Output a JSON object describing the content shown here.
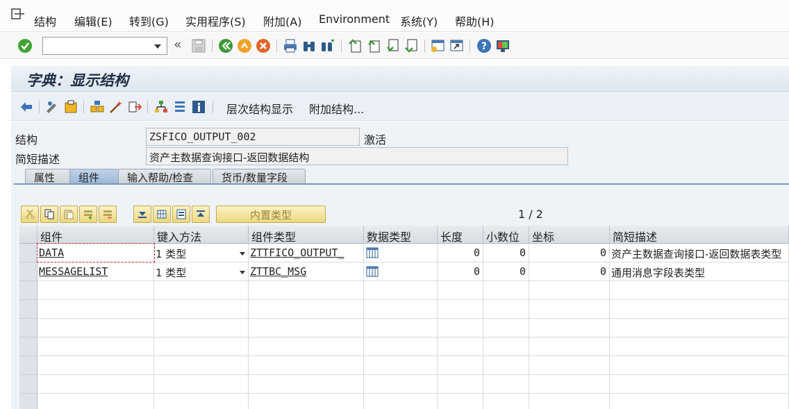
{
  "menubar": {
    "items": [
      "结构",
      "编辑(E)",
      "转到(G)",
      "实用程序(S)",
      "附加(A)",
      "Environment",
      "系统(Y)",
      "帮助(H)"
    ]
  },
  "toolbar": {
    "command_field_value": "",
    "back_glyph": "«"
  },
  "page": {
    "title": "字典：显示结构"
  },
  "app_toolbar": {
    "hierarchy_label": "层次结构显示",
    "append_structure_label": "附加结构..."
  },
  "form": {
    "structure_label": "结构",
    "structure_value": "ZSFICO_OUTPUT_002",
    "status": "激活",
    "short_desc_label": "简短描述",
    "short_desc_value": "资产主数据查询接口-返回数据结构"
  },
  "tabs": [
    "属性",
    "组件",
    "输入帮助/检查",
    "货币/数量字段"
  ],
  "grid_toolbar": {
    "builtin_type_label": "内置类型",
    "pager": "1 / 2"
  },
  "table": {
    "columns": [
      "组件",
      "键入方法",
      "组件类型",
      "数据类型",
      "长度",
      "小数位",
      "坐标",
      "简短描述"
    ],
    "rows": [
      {
        "component": "DATA",
        "typing_method": "1 类型",
        "component_type": "ZTTFICO_OUTPUT_",
        "data_type": "",
        "length": "0",
        "decimals": "0",
        "coordinate": "0",
        "description": "资产主数据查询接口-返回数据表类型"
      },
      {
        "component": "MESSAGELIST",
        "typing_method": "1 类型",
        "component_type": "ZTTBC_MSG",
        "data_type": "",
        "length": "0",
        "decimals": "0",
        "coordinate": "0",
        "description": "通用消息字段表类型"
      }
    ]
  },
  "colors": {
    "title_bg": "#dde6ef",
    "tab_active": "#9bb7d6",
    "grid_button": "#ecd77f",
    "ok_green": "#3fa535"
  }
}
